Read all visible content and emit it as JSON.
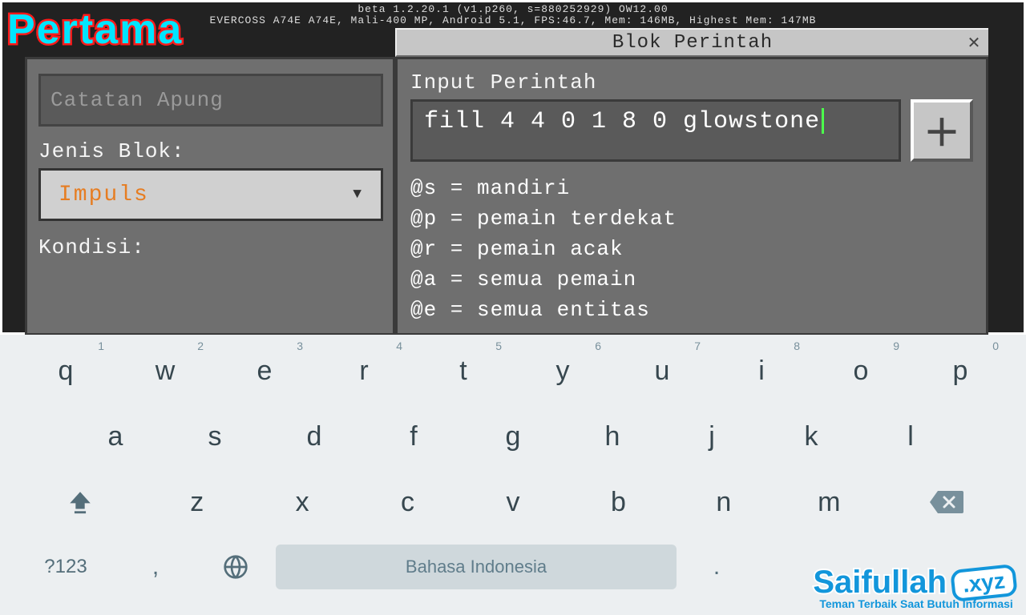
{
  "debug": {
    "line1": "beta 1.2.20.1 (v1.p260, s=880252929) OW12.00",
    "line2": "EVERCOSS A74E A74E, Mali-400 MP, Android 5.1, FPS:46.7, Mem: 146MB, Highest Mem: 147MB"
  },
  "overlay": {
    "title": "Pertama"
  },
  "dialog": {
    "title": "Blok Perintah"
  },
  "left": {
    "hover_placeholder": "Catatan Apung",
    "block_type_label": "Jenis Blok:",
    "block_type_value": "Impuls",
    "condition_label": "Kondisi:"
  },
  "right": {
    "input_label": "Input Perintah",
    "command_value": "fill 4 4 0 1 8 0 glowstone",
    "help": [
      "@s = mandiri",
      "@p = pemain terdekat",
      "@r = pemain acak",
      "@a = semua pemain",
      "@e = semua entitas"
    ]
  },
  "keyboard": {
    "row1": [
      {
        "k": "q",
        "n": "1"
      },
      {
        "k": "w",
        "n": "2"
      },
      {
        "k": "e",
        "n": "3"
      },
      {
        "k": "r",
        "n": "4"
      },
      {
        "k": "t",
        "n": "5"
      },
      {
        "k": "y",
        "n": "6"
      },
      {
        "k": "u",
        "n": "7"
      },
      {
        "k": "i",
        "n": "8"
      },
      {
        "k": "o",
        "n": "9"
      },
      {
        "k": "p",
        "n": "0"
      }
    ],
    "row2": [
      "a",
      "s",
      "d",
      "f",
      "g",
      "h",
      "j",
      "k",
      "l"
    ],
    "row3": [
      "z",
      "x",
      "c",
      "v",
      "b",
      "n",
      "m"
    ],
    "sym_label": "?123",
    "space_label": "Bahasa Indonesia",
    "comma": ",",
    "period": "."
  },
  "watermark": {
    "name": "Saifullah",
    "suffix": ".xyz",
    "tagline": "Teman Terbaik Saat Butuh Informasi"
  }
}
